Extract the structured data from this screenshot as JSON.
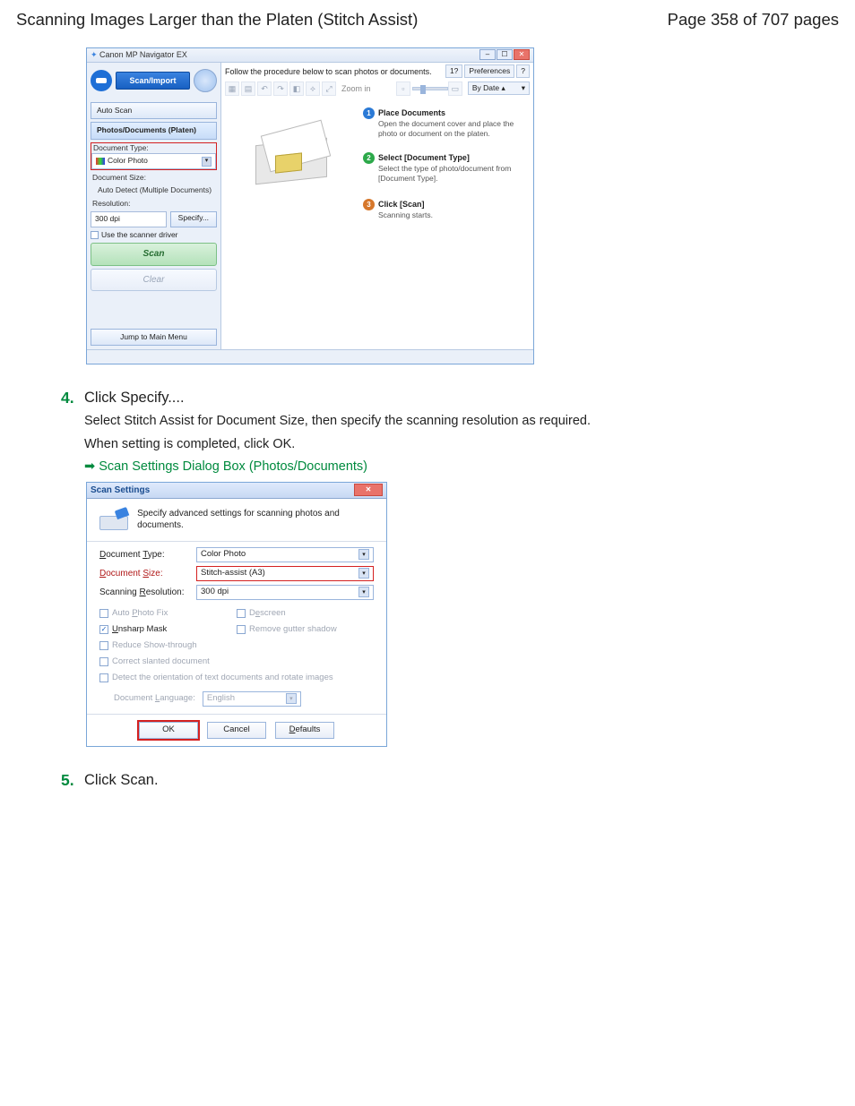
{
  "header": {
    "title": "Scanning Images Larger than the Platen (Stitch Assist)",
    "page_label": "Page 358 of 707 pages"
  },
  "fig1": {
    "window_title": "Canon MP Navigator EX",
    "scan_import": "Scan/Import",
    "procedure_text": "Follow the procedure below to scan photos or documents.",
    "guide_btn": "1?",
    "preferences_btn": "Preferences",
    "help_btn": "?",
    "zoom_label": "Zoom in",
    "sort_label": "By Date  ▴",
    "tabs": {
      "auto": "Auto Scan",
      "photos": "Photos/Documents (Platen)"
    },
    "doc_type_label": "Document Type:",
    "doc_type_value": "Color Photo",
    "doc_size_label": "Document Size:",
    "doc_size_value": "Auto Detect (Multiple Documents)",
    "res_label": "Resolution:",
    "res_value": "300 dpi",
    "specify_btn": "Specify...",
    "use_driver": "Use the scanner driver",
    "scan_btn": "Scan",
    "clear_btn": "Clear",
    "jump_btn": "Jump to Main Menu",
    "steps": {
      "s1_title": "Place Documents",
      "s1_desc": "Open the document cover and place the photo or document on the platen.",
      "s2_title": "Select [Document Type]",
      "s2_desc": "Select the type of photo/document from [Document Type].",
      "s3_title": "Click [Scan]",
      "s3_desc": "Scanning starts."
    }
  },
  "step4": {
    "num": "4.",
    "lead": "Click Specify....",
    "p1": "Select Stitch Assist for Document Size, then specify the scanning resolution as required.",
    "p2": "When setting is completed, click OK.",
    "link": "Scan Settings Dialog Box (Photos/Documents)"
  },
  "fig2": {
    "title": "Scan Settings",
    "intro": "Specify advanced settings for scanning photos and documents.",
    "rows": {
      "doc_type_l": "Document Type:",
      "doc_type_v": "Color Photo",
      "doc_size_l": "Document Size:",
      "doc_size_v": "Stitch-assist (A3)",
      "res_l": "Scanning Resolution:",
      "res_v": "300 dpi"
    },
    "chks": {
      "auto_photo_fix": "Auto Photo Fix",
      "descreen": "Descreen",
      "unsharp": "Unsharp Mask",
      "gutter": "Remove gutter shadow",
      "showthrough": "Reduce Show-through",
      "slanted": "Correct slanted document",
      "orientation": "Detect the orientation of text documents and rotate images"
    },
    "lang_l": "Document Language:",
    "lang_v": "English",
    "ok": "OK",
    "cancel": "Cancel",
    "defaults": "Defaults"
  },
  "step5": {
    "num": "5.",
    "lead": "Click Scan."
  }
}
